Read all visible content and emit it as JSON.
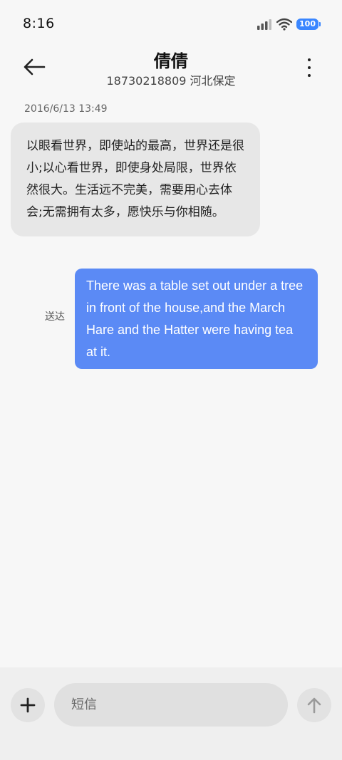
{
  "status_bar": {
    "time": "8:16",
    "battery": "100",
    "signal_icon": "cellular-signal-icon",
    "wifi_icon": "wifi-icon"
  },
  "header": {
    "contact_name": "倩倩",
    "contact_subtitle": "18730218809 河北保定",
    "back_icon": "arrow-left-icon",
    "more_icon": "more-vertical-icon"
  },
  "conversation": {
    "timestamp": "2016/6/13 13:49",
    "incoming_message": "以眼看世界，即使站的最高，世界还是很小;以心看世界，即使身处局限，世界依然很大。生活远不完美，需要用心去体会;无需拥有太多，愿快乐与你相随。",
    "outgoing_message": "There was a table set out under a tree in front of the house,and the March Hare and the Hatter were having tea at it.",
    "outgoing_status": "送达"
  },
  "composer": {
    "placeholder": "短信",
    "value": "",
    "add_icon": "plus-icon",
    "send_icon": "arrow-up-icon"
  },
  "colors": {
    "background": "#f7f7f7",
    "incoming_bubble": "#e7e7e7",
    "outgoing_bubble": "#5b8af5",
    "battery_accent": "#3a86ff"
  }
}
